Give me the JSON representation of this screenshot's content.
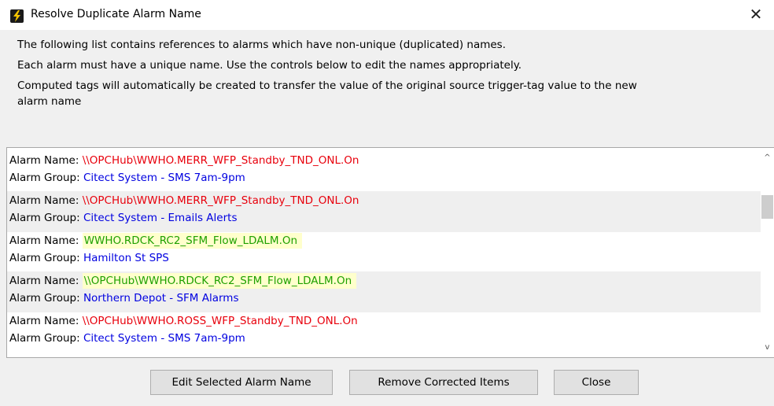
{
  "window": {
    "title": "Resolve Duplicate Alarm Name",
    "close_glyph": "✕"
  },
  "description": {
    "line1": "The following list contains references to alarms which have non-unique (duplicated) names.",
    "line2": "Each alarm must have a unique name. Use the  controls below to edit the names appropriately.",
    "line3a": "Computed tags will automatically be created to transfer the value of the original source trigger-tag value to the new",
    "line3b": "alarm name"
  },
  "labels": {
    "alarm_name": "Alarm Name: ",
    "alarm_group": "Alarm Group: "
  },
  "alarms": [
    {
      "name": "\\\\OPCHub\\WWHO.MERR_WFP_Standby_TND_ONL.On",
      "group": "Citect System - SMS 7am-9pm",
      "name_color": "#e8000c"
    },
    {
      "name": "\\\\OPCHub\\WWHO.MERR_WFP_Standby_TND_ONL.On",
      "group": "Citect System - Emails Alerts",
      "name_color": "#e8000c"
    },
    {
      "name": "WWHO.RDCK_RC2_SFM_Flow_LDALM.On",
      "group": "Hamilton St SPS",
      "name_color": "#1ea000"
    },
    {
      "name": "\\\\OPCHub\\WWHO.RDCK_RC2_SFM_Flow_LDALM.On",
      "group": "Northern Depot - SFM Alarms",
      "name_color": "#1ea000"
    },
    {
      "name": "\\\\OPCHub\\WWHO.ROSS_WFP_Standby_TND_ONL.On",
      "group": "Citect System - SMS 7am-9pm",
      "name_color": "#e8000c"
    }
  ],
  "buttons": {
    "edit": "Edit Selected Alarm Name",
    "remove": "Remove Corrected Items",
    "close": "Close"
  },
  "scroll": {
    "up_glyph": "^",
    "down_glyph": "v"
  }
}
